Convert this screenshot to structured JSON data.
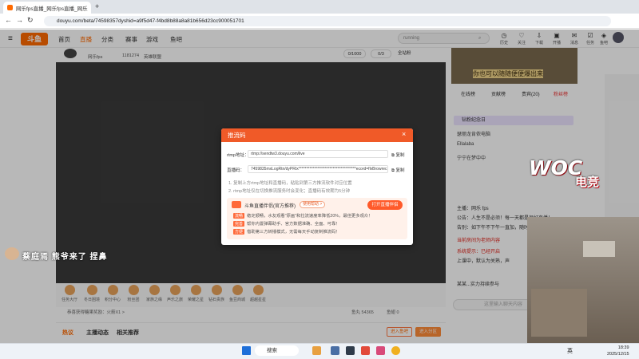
{
  "browser": {
    "tab_title": "网乐fps直播_网乐fps直播_网乐",
    "url": "douyu.com/beta/74598357dyshid=a9f5d47-f4bd8b88a8a81b656d23cc900051701"
  },
  "site": {
    "logo": "斗鱼",
    "nav": [
      "首页",
      "直播",
      "分类",
      "赛事",
      "游戏",
      "鱼吧"
    ],
    "search_placeholder": "running",
    "header_icons": [
      "历史",
      "关注",
      "下载",
      "开播",
      "消息",
      "任务",
      "鱼吧",
      "任务"
    ]
  },
  "streamer": {
    "name": "网乐fps",
    "room_id": "1181274",
    "team": "英雄联盟",
    "count_a": "0/1000",
    "count_b": "0/3",
    "btn": "全站粉"
  },
  "promo": {
    "text": "你也可以随随便便爆出来"
  },
  "rank_tabs": [
    "在线榜",
    "贡献榜",
    "贵宾(20)",
    "粉丝榜"
  ],
  "chat": {
    "rank_title": "钻粉纪念日",
    "lines": [
      "瑟丽龙肯侬电脑",
      "Ellalaba",
      "宁宁在梦中中",
      "主播：网乐 fps",
      "公告：人生不是必须！每一天都是很好直播！",
      "告别：如下午不下午一直加，随时加！",
      "当前房间为老师内容",
      "系统提示：已经开启",
      "上课中，默认为关熟，声",
      "某某...实力持续参与"
    ],
    "input_placeholder": "这里输入聊天内容",
    "send": "发送"
  },
  "gifts": [
    "任务大厅",
    "冬日困境",
    "积分中心",
    "粉丝团",
    "家族之缘",
    "声乐之旅",
    "荣耀之星",
    "钻石贵族",
    "鱼豆商城",
    "超越星星"
  ],
  "bottom_bar": {
    "notice": "恭喜获得糖果奖励：火箭X1 >",
    "fish_balls": "鱼丸 54365",
    "fish_fin": "鱼翅 0"
  },
  "page_tabs": [
    "热议",
    "主播动态",
    "相关推荐"
  ],
  "page_tab_btns": [
    "进入鱼吧",
    "进入分区"
  ],
  "modal": {
    "title": "推流码",
    "rtmp_label": "rtmp地址：",
    "rtmp_value": "rtmp://sendtw3.douyu.com/live",
    "key_label": "直播码：",
    "key_value": "7459835mxLogRtn/dyPRIx*************************************ecord=flvBrowrec",
    "copy": "复制",
    "notes": [
      "1. 复制上方rtmp地址和直播码，粘贴到第三方推流软件对应位置",
      "2. rtmp地址仅在切换推流服务时会变化；直播码有效期为5分钟"
    ],
    "ad_title": "斗鱼直播伴侣(官方推荐)",
    "ad_tag": "使用帮助 >",
    "ad_button": "打开直播伴侣",
    "ad_rows": [
      {
        "tag": "流畅",
        "text": "稳定顺畅，水友观看\"原画\"和拉流速度率降低20%，最佳更多观众！"
      },
      {
        "tag": "完善",
        "text": "帮你内置弹幕助手、官方数据准确、全面、可靠！"
      },
      {
        "tag": "方便",
        "text": "借助第三方转播模式，无需每天手动复制推流码！"
      }
    ]
  },
  "overlay": {
    "woc": "WOC",
    "woc_sub": "电竞",
    "caption": "蔡庭焉 熊爷来了 捏鼻"
  },
  "taskbar": {
    "search": "搜索",
    "lang": "英",
    "time": "18:39",
    "date": "2025/12/15"
  },
  "colors": {
    "accent": "#f05a28",
    "brand": "#ff6a00"
  }
}
